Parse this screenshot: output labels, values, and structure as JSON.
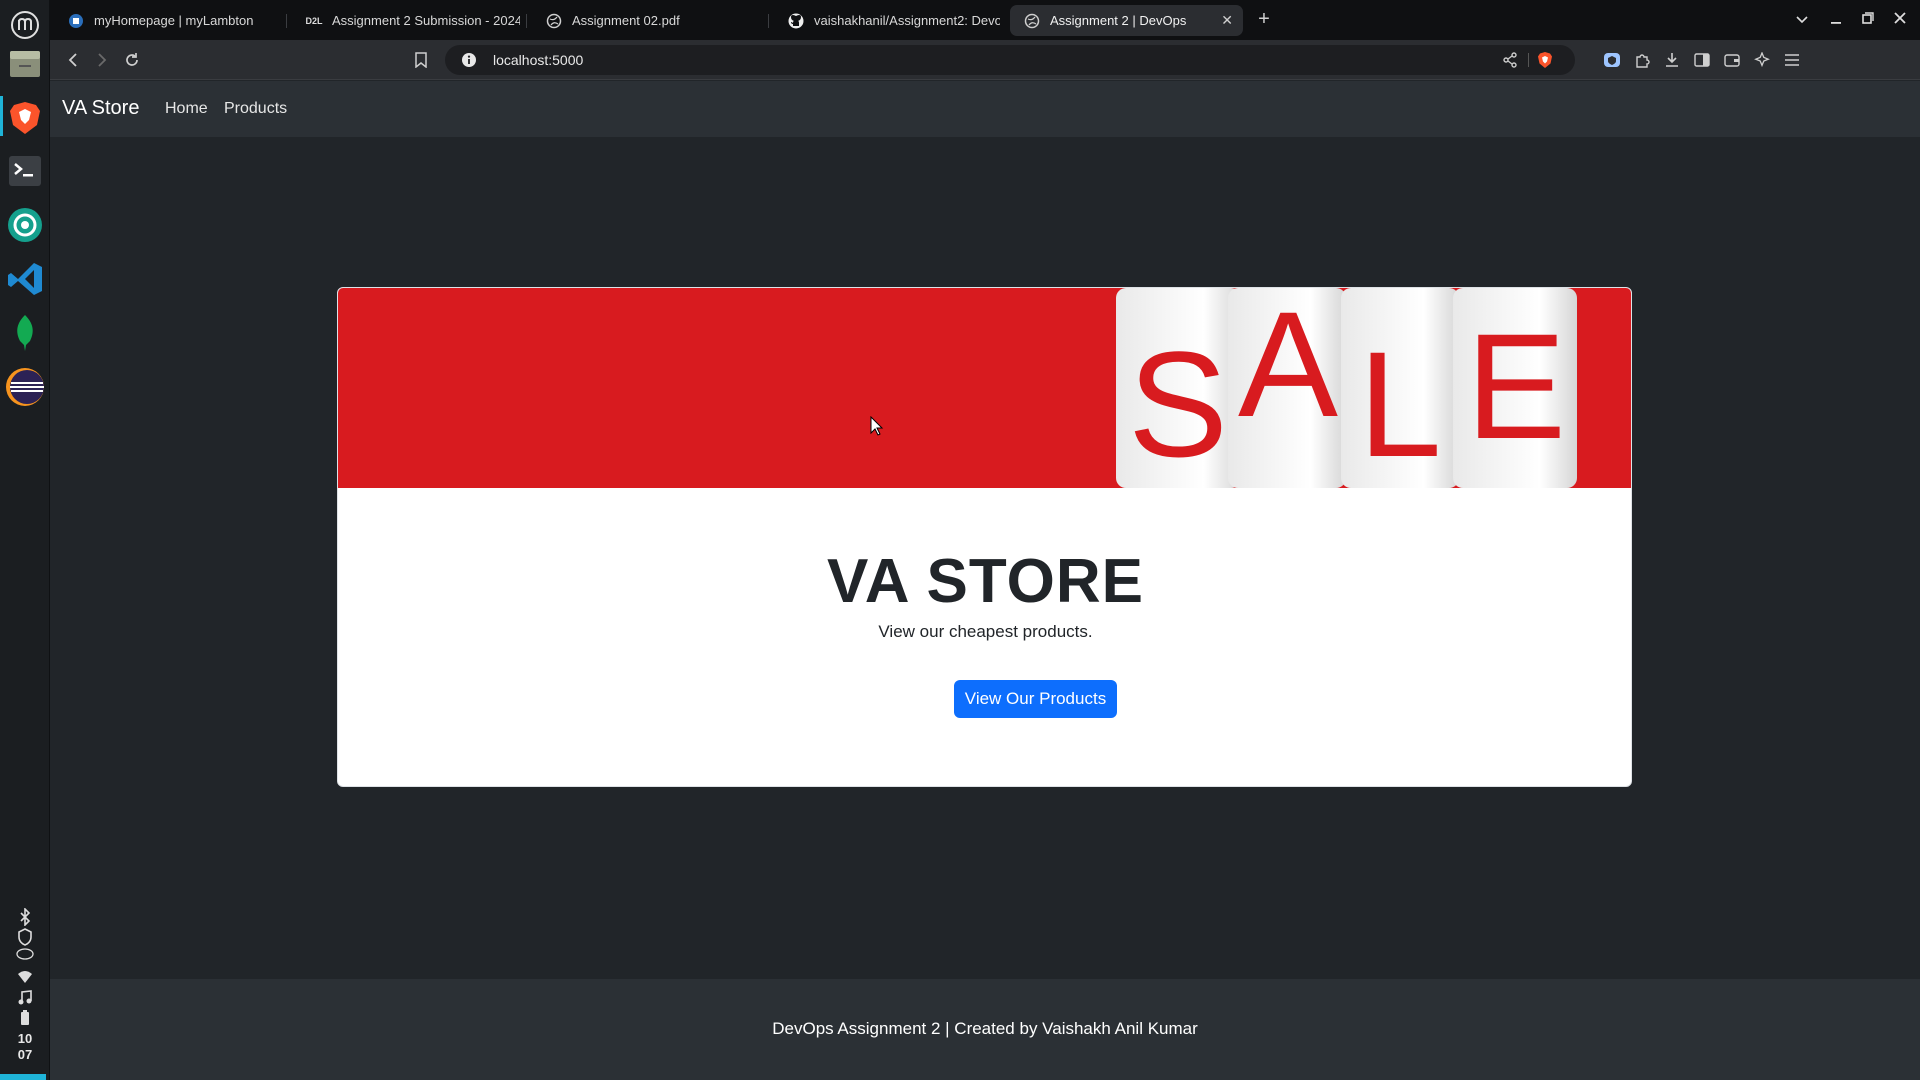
{
  "browser": {
    "tabs": [
      {
        "title": "myHomepage | myLambton",
        "active": false,
        "icon": "lambton-icon"
      },
      {
        "title": "Assignment 2 Submission - 2024",
        "active": false,
        "icon": "d2l-icon"
      },
      {
        "title": "Assignment 02.pdf",
        "active": false,
        "icon": "globe-icon"
      },
      {
        "title": "vaishakhanil/Assignment2: Devo",
        "active": false,
        "icon": "github-icon"
      },
      {
        "title": "Assignment 2 | DevOps",
        "active": true,
        "icon": "globe-icon"
      }
    ],
    "url": "localhost:5000",
    "d2l_badge": "D2L"
  },
  "os": {
    "clock_hour": "10",
    "clock_minute": "07"
  },
  "site": {
    "brand": "VA Store",
    "nav": {
      "home": "Home",
      "products": "Products"
    },
    "banner_text": "SALE",
    "hero_title": "VA STORE",
    "hero_subtitle": "View our cheapest products.",
    "hero_button": "View Our Products",
    "footer": "DevOps Assignment 2 | Created by Vaishakh Anil Kumar"
  },
  "colors": {
    "accent": "#0d6efd",
    "banner_red": "#d81b1f",
    "page_bg": "#212529",
    "navbar_bg": "#2b3035"
  }
}
